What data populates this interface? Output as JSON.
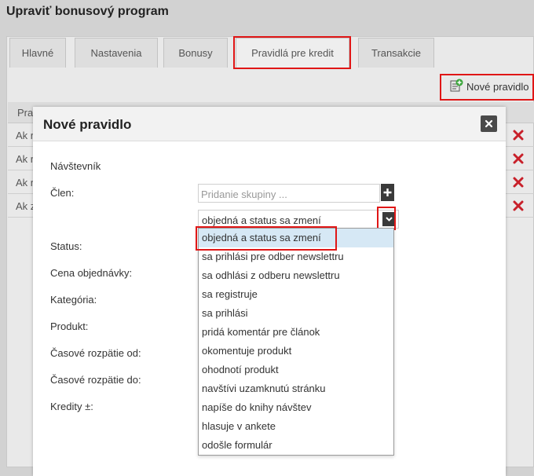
{
  "page": {
    "title": "Upraviť bonusový program"
  },
  "tabs": [
    {
      "label": "Hlavné"
    },
    {
      "label": "Nastavenia"
    },
    {
      "label": "Bonusy"
    },
    {
      "label": "Pravidlá pre kredit"
    },
    {
      "label": "Transakcie"
    }
  ],
  "toolbar": {
    "new_rule_label": "Nové pravidlo"
  },
  "background_list": {
    "header_partial": "Prav",
    "rows": [
      {
        "text": "Ak r"
      },
      {
        "text": "Ak r"
      },
      {
        "text": "Ak r"
      },
      {
        "text": "Ak z"
      }
    ]
  },
  "modal": {
    "title": "Nové pravidlo",
    "labels": {
      "visitor": "Návštevník",
      "member": "Člen",
      "status": "Status:",
      "order_price": "Cena objednávky:",
      "category": "Kategória:",
      "product": "Produkt:",
      "time_from": "Časové rozpätie od:",
      "time_to": "Časové rozpätie do:",
      "credits": "Kredity ±:"
    },
    "member_group_placeholder": "Pridanie skupiny ...",
    "trigger_select": {
      "value": "objedná a status sa zmení",
      "options": [
        "objedná a status sa zmení",
        "sa prihlási pre odber newslettru",
        "sa odhlási z odberu newslettru",
        "sa registruje",
        "sa prihlási",
        "pridá komentár pre článok",
        "okomentuje produkt",
        "ohodnotí produkt",
        "navštívi uzamknutú stránku",
        "napíše do knihy návštev",
        "hlasuje v ankete",
        "odošle formulár"
      ]
    }
  },
  "colors": {
    "highlight": "#e01616",
    "delete": "#c8202a",
    "accent_green": "#3aa53a"
  }
}
